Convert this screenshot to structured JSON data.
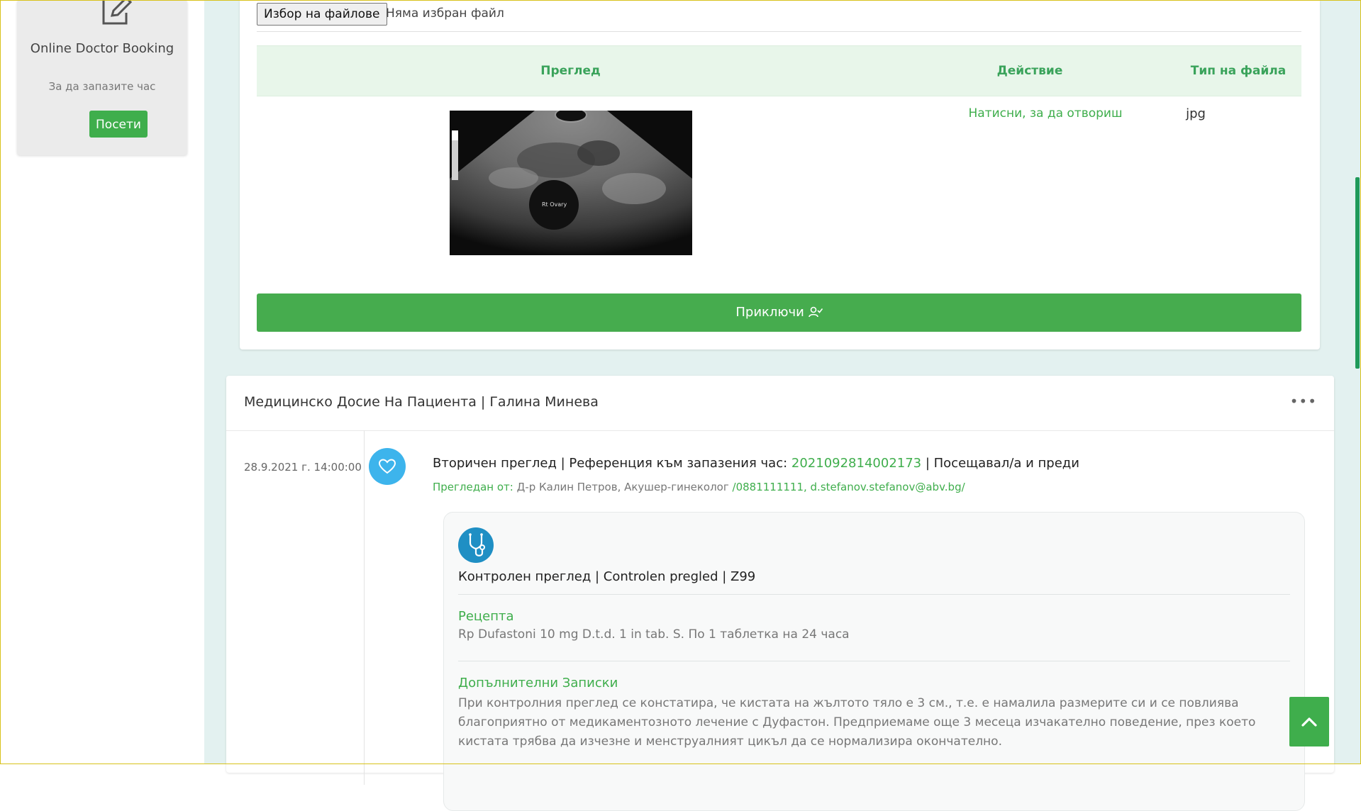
{
  "sidebar": {
    "promo": {
      "icon": "edit-square-icon",
      "title": "Online Doctor Booking",
      "subtitle": "За да запазите час",
      "button_label": "Посети"
    }
  },
  "upload": {
    "choose_label": "Избор на файлове",
    "status": "Няма избран файл"
  },
  "files_table": {
    "headers": [
      "Преглед",
      "Действие",
      "Тип на файла"
    ],
    "rows": [
      {
        "preview_caption": "Rt Ovary",
        "action": "Натисни, за да отвориш",
        "type": "jpg"
      }
    ]
  },
  "finish_button": {
    "label": "Приключи",
    "icon": "user-check-icon"
  },
  "record": {
    "title": "Медицинско Досие На Пациента | Галина Минева",
    "more_label": "•••",
    "entry": {
      "date": "28.9.2021 г. 14:00:00",
      "icon": "heart-icon",
      "title_prefix": "Вторичен преглед | Референция към запазения час: ",
      "reference": "2021092814002173",
      "title_suffix": " | Посещавал/а и преди",
      "examined_label": "Прегледан от: ",
      "examined_by": "Д-р Калин Петров, Акушер-гинеколог ",
      "contacts": "/0881111111, d.stefanov.stefanov@abv.bg/",
      "diagnosis": "Контролен преглед | Controlen pregled | Z99",
      "prescription_label": "Рецепта",
      "prescription_text": "Rp Dufastoni 10 mg D.t.d. 1 in tab. S. По 1 таблетка на 24 часа",
      "notes_label": "Допълнителни Записки",
      "notes_text": "При контролния преглед се констатира, че кистата на жълтото тяло е 3 см., т.е. е намалила размерите си и се повлиява благоприятно от медикаментозното лечение с Дуфастон. Предприемаме още 3 месеца изчакателно поведение, през което кистата трябва да изчезне и менструалният цикъл да се нормализира окончателно."
    }
  },
  "scroll_top": {
    "icon": "chevron-up-icon"
  },
  "colors": {
    "accent_green": "#3fae4c",
    "header_green": "#3aa35b",
    "timeline_blue": "#3db4ec",
    "page_bg": "#e3f1f0"
  }
}
